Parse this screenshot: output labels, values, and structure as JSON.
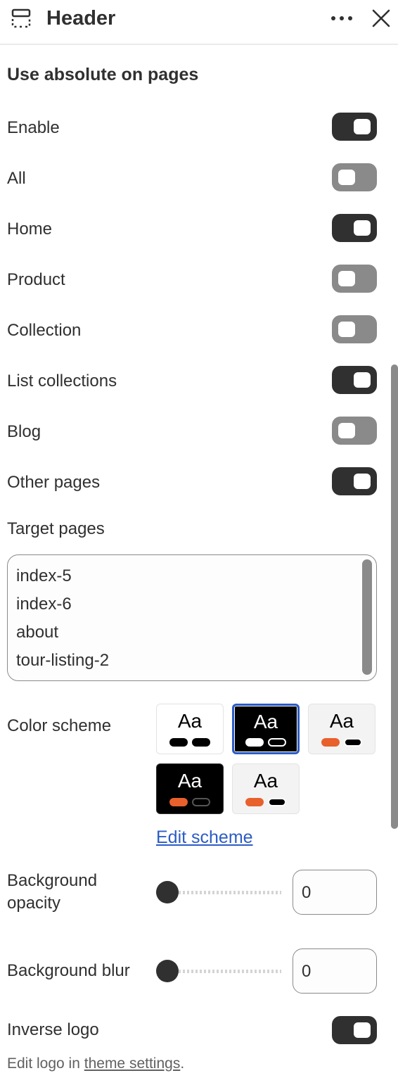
{
  "header": {
    "title": "Header",
    "icon": "header-section-icon",
    "more_icon": "more-horizontal-icon",
    "close_icon": "close-icon"
  },
  "section": {
    "title": "Use absolute on pages"
  },
  "toggles": [
    {
      "label": "Enable",
      "on": true
    },
    {
      "label": "All",
      "on": false
    },
    {
      "label": "Home",
      "on": true
    },
    {
      "label": "Product",
      "on": false
    },
    {
      "label": "Collection",
      "on": false
    },
    {
      "label": "List collections",
      "on": true
    },
    {
      "label": "Blog",
      "on": false
    },
    {
      "label": "Other pages",
      "on": true
    }
  ],
  "target_pages": {
    "label": "Target pages",
    "lines": [
      "index-5",
      "index-6",
      "about",
      "tour-listing-2"
    ]
  },
  "color_scheme": {
    "label": "Color scheme",
    "swatches": [
      {
        "text": "Aa",
        "bg": "#ffffff",
        "fg": "#000000",
        "pill1": "#000000",
        "pill2": "#000000",
        "pill2_outline": "#000000",
        "selected": false
      },
      {
        "text": "Aa",
        "bg": "#000000",
        "fg": "#ffffff",
        "pill1": "#ffffff",
        "pill2": "#000000",
        "pill2_outline": "#ffffff",
        "selected": true
      },
      {
        "text": "Aa",
        "bg": "#f3f3f3",
        "fg": "#000000",
        "pill1": "#e8602c",
        "pill2": "#000000",
        "pill2_outline": "#000000",
        "selected": false
      },
      {
        "text": "Aa",
        "bg": "#000000",
        "fg": "#ffffff",
        "pill1": "#e8602c",
        "pill2": "#000000",
        "pill2_outline": "#555555",
        "selected": false
      },
      {
        "text": "Aa",
        "bg": "#f3f3f3",
        "fg": "#000000",
        "pill1": "#e8602c",
        "pill2": "#000000",
        "pill2_outline": "#000000",
        "selected": false
      }
    ],
    "edit_link": "Edit scheme"
  },
  "background_opacity": {
    "label_line1": "Background",
    "label_line2": "opacity",
    "value": "0"
  },
  "background_blur": {
    "label": "Background blur",
    "value": "0"
  },
  "inverse_logo": {
    "label": "Inverse logo",
    "on": true
  },
  "help": {
    "prefix": "Edit logo in ",
    "link": "theme settings",
    "suffix": "."
  },
  "colors": {
    "toggle_on": "#303030",
    "toggle_off": "#8a8a8a",
    "link": "#2c5cc5",
    "accent_orange": "#e8602c"
  }
}
